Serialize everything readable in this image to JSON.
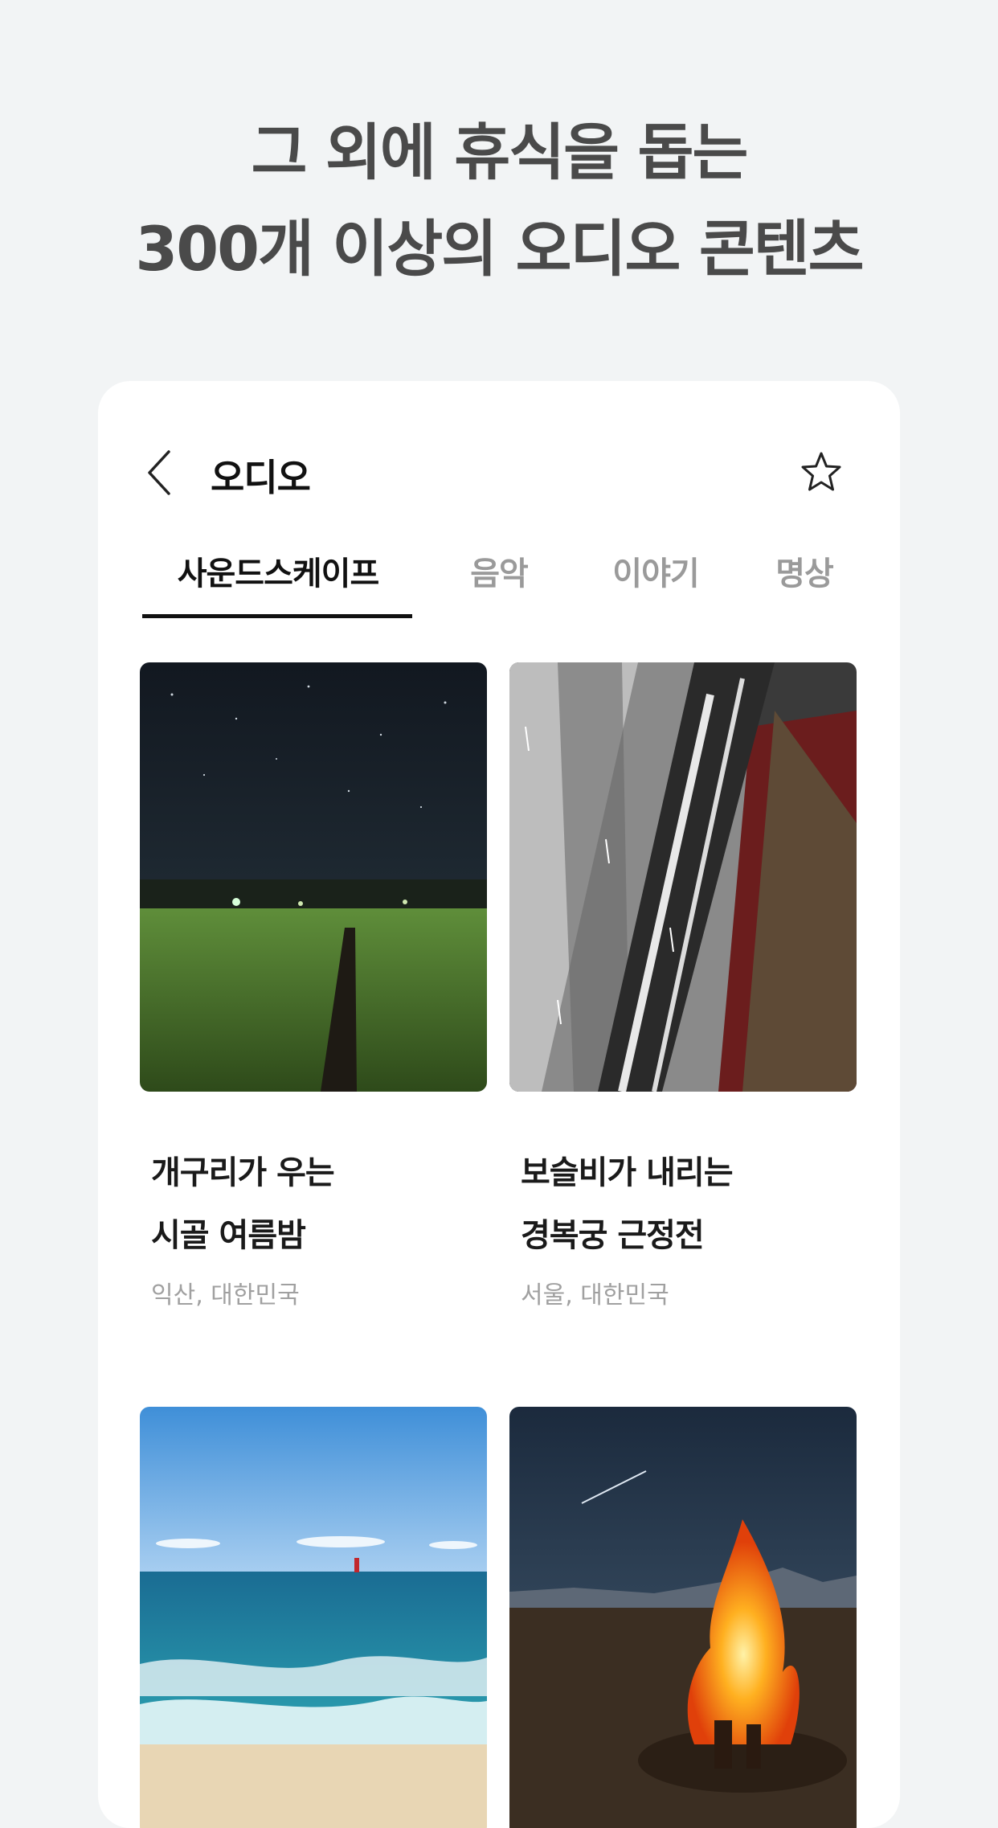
{
  "headline": {
    "line1": "그 외에 휴식을 돕는",
    "line2": "300개 이상의 오디오 콘텐츠"
  },
  "topbar": {
    "title": "오디오",
    "back_icon": "chevron-left-icon",
    "favorite_icon": "star-outline-icon"
  },
  "tabs": [
    {
      "label": "사운드스케이프",
      "active": true
    },
    {
      "label": "음악",
      "active": false
    },
    {
      "label": "이야기",
      "active": false
    },
    {
      "label": "명상",
      "active": false
    }
  ],
  "items": [
    {
      "title_line1": "개구리가 우는",
      "title_line2": "시골 여름밤",
      "location": "익산, 대한민국"
    },
    {
      "title_line1": "보슬비가 내리는",
      "title_line2": "경복궁 근정전",
      "location": "서울, 대한민국"
    },
    {
      "title_line1": "",
      "title_line2": "",
      "location": ""
    },
    {
      "title_line1": "",
      "title_line2": "",
      "location": ""
    }
  ],
  "colors": {
    "background": "#f2f4f5",
    "card": "#ffffff",
    "active_tab": "#111111",
    "inactive_tab": "#9a9a9a",
    "headline": "#4a4a4a",
    "subtitle": "#a0a0a0"
  }
}
